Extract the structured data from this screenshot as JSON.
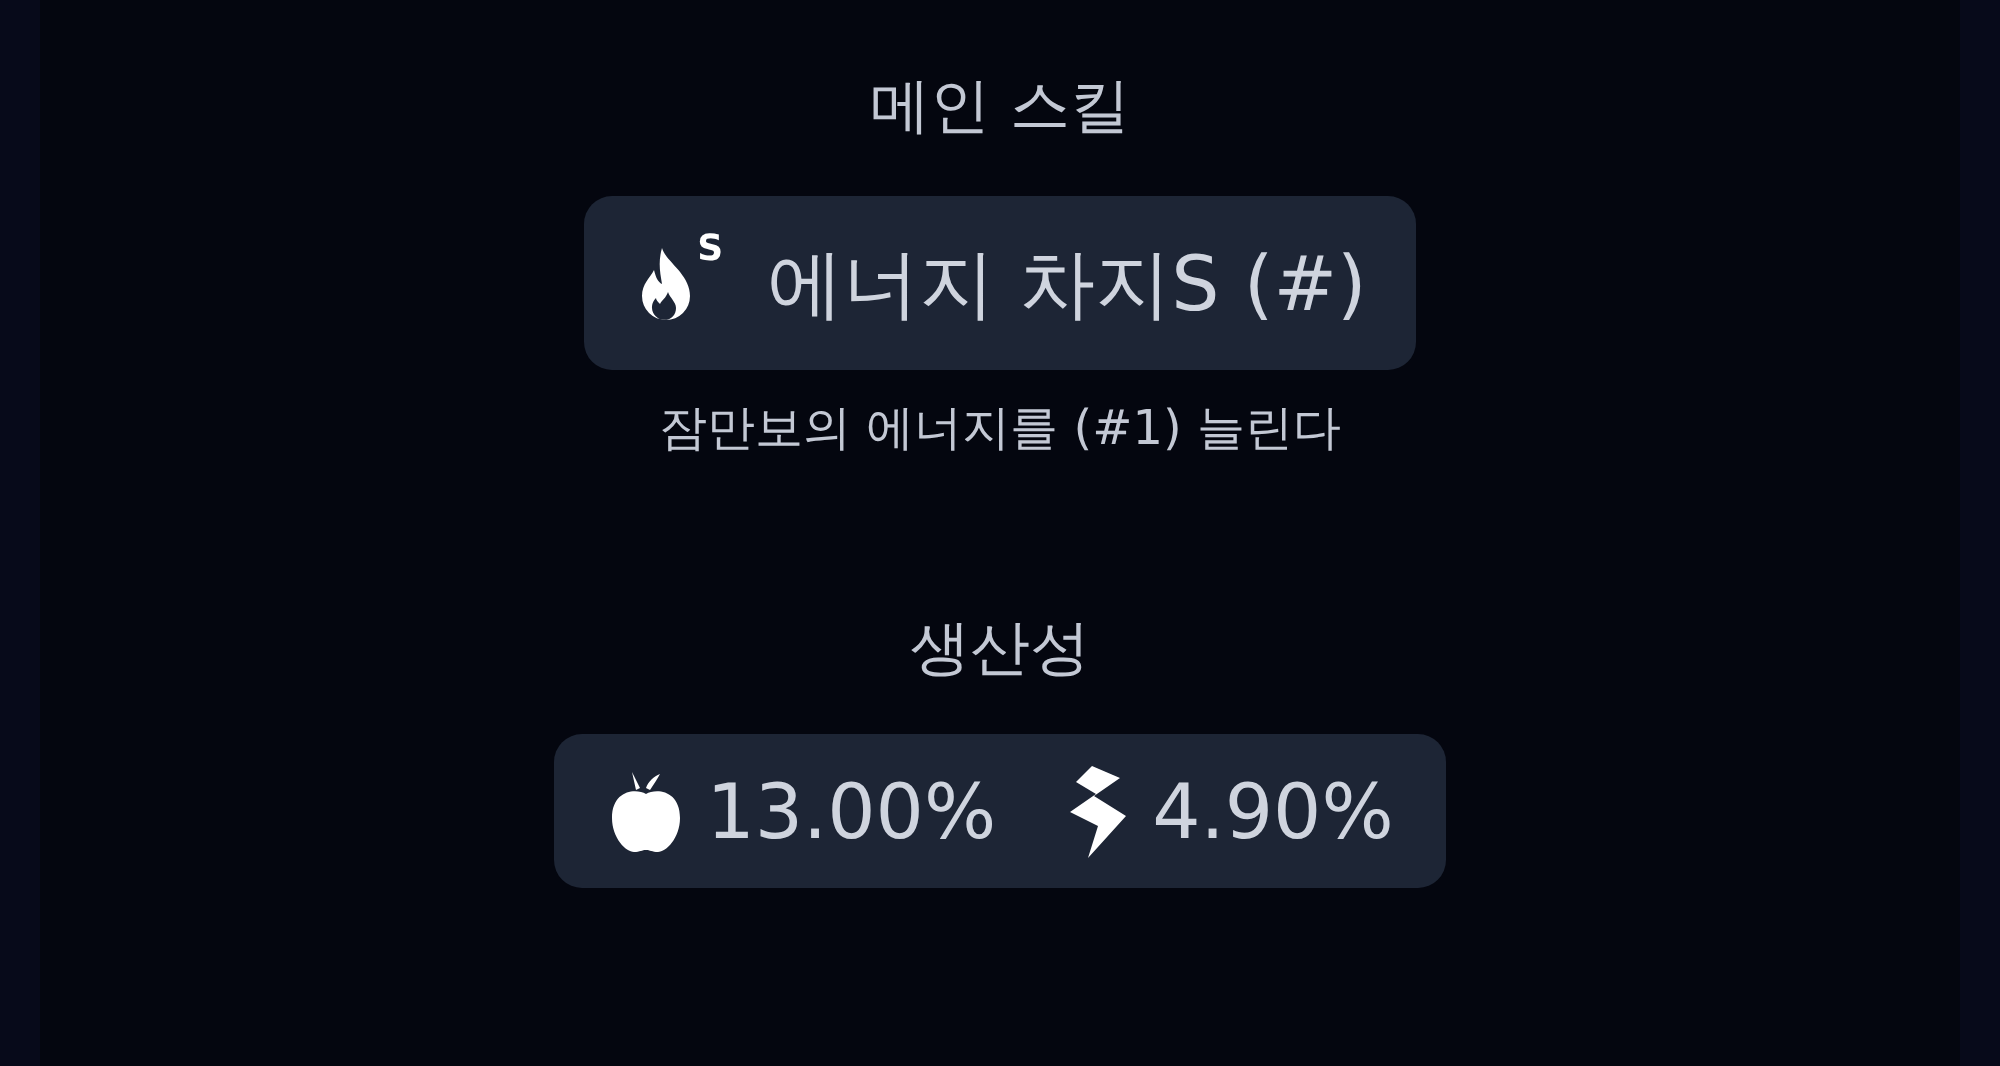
{
  "main_skill": {
    "heading": "메인 스킬",
    "icon_badge": "S",
    "name": "에너지 차지S (#)",
    "description": "잠만보의 에너지를 (#1) 늘린다"
  },
  "productivity": {
    "heading": "생산성",
    "stats": [
      {
        "kind": "food",
        "value": "13.00%"
      },
      {
        "kind": "skill",
        "value": "4.90%"
      }
    ]
  }
}
